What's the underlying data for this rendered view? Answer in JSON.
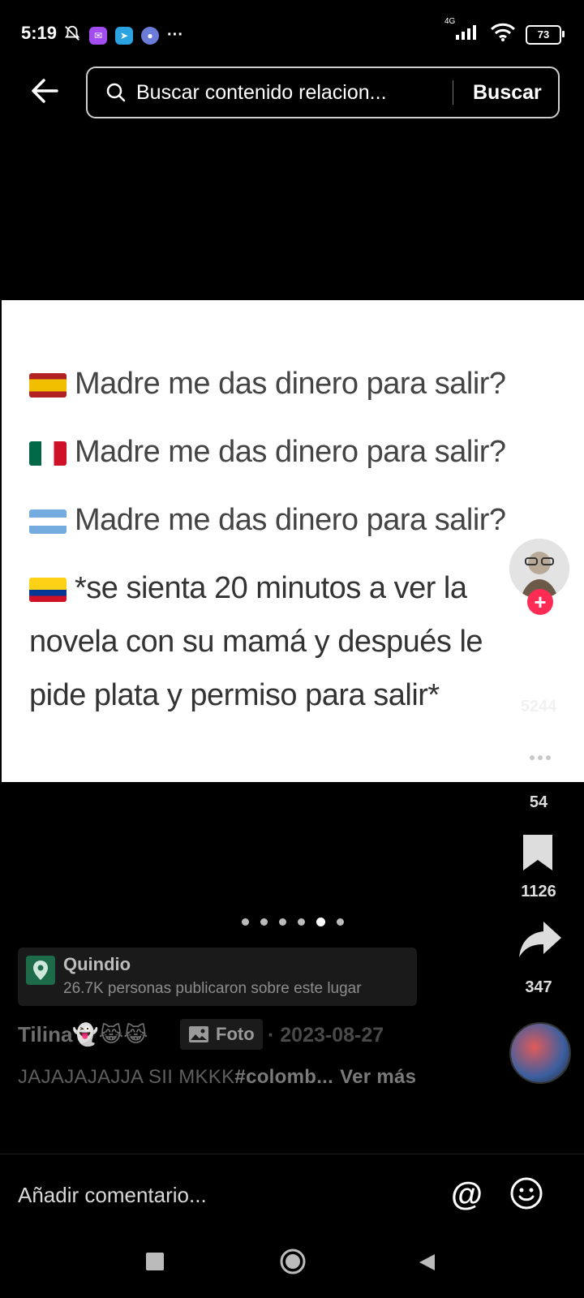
{
  "status_bar": {
    "time": "5:19",
    "network": "4G",
    "battery": "73"
  },
  "header": {
    "search_placeholder": "Buscar contenido relacion...",
    "search_button": "Buscar"
  },
  "post": {
    "lines": [
      {
        "flag": "spain-flag",
        "text": "Madre me das dinero para salir?"
      },
      {
        "flag": "mexico-flag",
        "text": "Madre me das dinero para salir?"
      },
      {
        "flag": "argentina-flag",
        "text": "Madre me das dinero para salir?"
      },
      {
        "flag": "colombia-flag",
        "text": "*se sienta 20 minutos a ver la"
      }
    ],
    "line5": "novela con su mamá y después le",
    "line6": "pide plata y permiso para salir*",
    "carousel": {
      "total": 6,
      "active_index": 4
    }
  },
  "actions": {
    "likes": "5244",
    "comments": "54",
    "bookmarks": "1126",
    "shares": "347"
  },
  "location": {
    "name": "Quindio",
    "subtitle": "26.7K personas publicaron sobre este lugar"
  },
  "author": {
    "name": "Tilina👻😹😹",
    "type_label": "Foto",
    "date": "· 2023-08-27"
  },
  "caption": {
    "text": "JAJAJAJAJJA SII MKKK",
    "hashtag": "#colomb...",
    "more": "Ver más"
  },
  "comment_bar": {
    "placeholder": "Añadir comentario...",
    "at": "@"
  },
  "colors": {
    "background": "#000000",
    "accent": "#fe2c55"
  }
}
